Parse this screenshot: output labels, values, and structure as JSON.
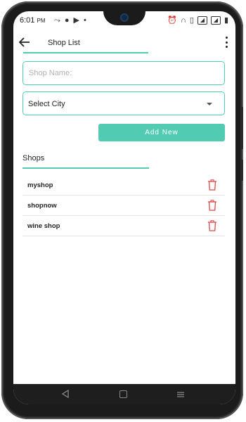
{
  "status_bar": {
    "time": "6:01",
    "time_suffix": "PM"
  },
  "app_bar": {
    "title": "Shop List"
  },
  "form": {
    "shop_name_placeholder": "Shop Name:",
    "city_select_value": "Select City",
    "add_button_label": "Add New"
  },
  "shops_section": {
    "title": "Shops",
    "items": [
      {
        "name": "myshop"
      },
      {
        "name": "shopnow"
      },
      {
        "name": "wine shop"
      }
    ]
  },
  "colors": {
    "accent": "#4ecdb4",
    "button": "#52cbb3",
    "delete_icon": "#e04646"
  },
  "icons": {
    "back": "arrow-left-icon",
    "menu": "more-vertical-icon",
    "dropdown": "caret-down-icon",
    "delete": "trash-icon"
  }
}
